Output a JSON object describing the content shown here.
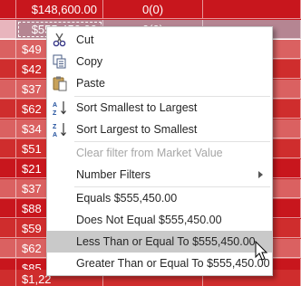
{
  "sheet": {
    "rows": [
      {
        "amount": "$148,600.00",
        "count": "0(0)"
      },
      {
        "amount": "$555,450.00",
        "count": "0(0)"
      },
      {
        "amount": "$49",
        "count": ""
      },
      {
        "amount": "$42",
        "count": ""
      },
      {
        "amount": "$37",
        "count": ""
      },
      {
        "amount": "$62",
        "count": ""
      },
      {
        "amount": "$34",
        "count": ""
      },
      {
        "amount": "$51",
        "count": ""
      },
      {
        "amount": "$21",
        "count": ""
      },
      {
        "amount": "$37",
        "count": ""
      },
      {
        "amount": "$88",
        "count": ""
      },
      {
        "amount": "$59",
        "count": ""
      },
      {
        "amount": "$62",
        "count": ""
      },
      {
        "amount": "$85",
        "count": ""
      },
      {
        "amount": "$1,22",
        "count": ""
      }
    ]
  },
  "menu": {
    "cut": "Cut",
    "copy": "Copy",
    "paste": "Paste",
    "sort_asc": "Sort Smallest to Largest",
    "sort_desc": "Sort Largest to Smallest",
    "clear_filter": "Clear filter from Market Value",
    "number_filters": "Number Filters",
    "equals": "Equals $555,450.00",
    "not_equal": "Does Not Equal $555,450.00",
    "less_equal": "Less Than or Equal To $555,450.00",
    "greater_equal": "Greater Than or Equal To $555,450.00"
  },
  "colors": {
    "bright_red": "#c8161d",
    "pale_red": "#da6161",
    "menu_hover": "#c9c9c9"
  },
  "icons": {
    "cut": "scissors-icon",
    "copy": "copy-icon",
    "paste": "paste-icon",
    "sort_asc": "sort-ascending-icon",
    "sort_desc": "sort-descending-icon",
    "submenu": "chevron-right-icon",
    "pointer": "mouse-pointer-icon"
  }
}
